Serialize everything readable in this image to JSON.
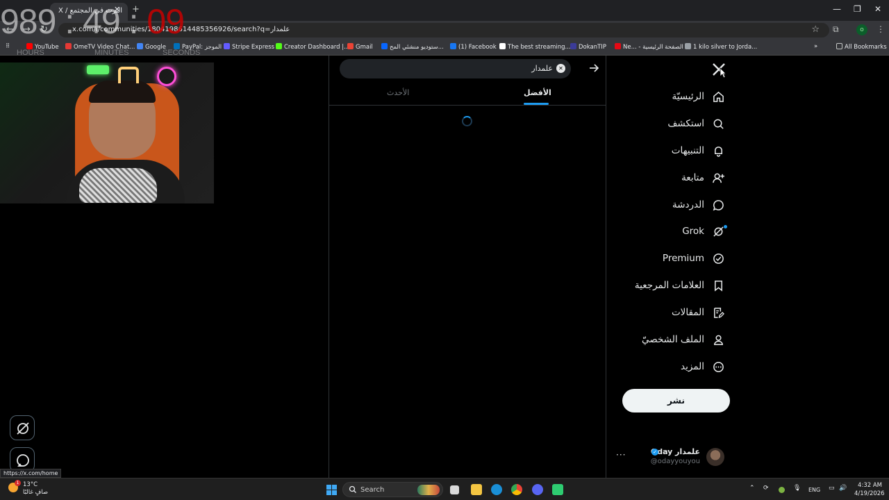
{
  "browser": {
    "tab_title": "الترث في المجتمع / X",
    "url": "x.com/i/communities/1804198614485356926/search?q=علمدار",
    "status_url": "https://x.com/home",
    "bookmarks": [
      {
        "label": "YouTube",
        "color": "#ff0000"
      },
      {
        "label": "OmeTV Video Chat...",
        "color": "#e53935"
      },
      {
        "label": "Google",
        "color": "#4285f4"
      },
      {
        "label": "PayPal: الموجز",
        "color": "#0070ba"
      },
      {
        "label": "Stripe Express",
        "color": "#635bff"
      },
      {
        "label": "Creator Dashboard |...",
        "color": "#53fc18"
      },
      {
        "label": "Gmail",
        "color": "#ea4335"
      },
      {
        "label": "ستوديو منشئي المح...",
        "color": "#0866ff"
      },
      {
        "label": "(1) Facebook",
        "color": "#1877f2"
      },
      {
        "label": "The best streaming...",
        "color": "#ffffff"
      },
      {
        "label": "DokanTIP",
        "color": "#3b3b98"
      },
      {
        "label": "Ne... - الصفحة الرئيسية",
        "color": "#e50914"
      },
      {
        "label": "1 kilo silver to Jorda...",
        "color": "#9aa0a6"
      }
    ],
    "all_bookmarks": "All Bookmarks",
    "profile_initial": "o"
  },
  "overlay": {
    "timer_hm": "989 : 49 : ",
    "timer_s": "09",
    "labels": [
      "HOURS",
      "MINUTES",
      "SECONDS"
    ]
  },
  "search": {
    "query": "علمدار",
    "tabs": [
      {
        "label": "الأفضل",
        "active": true
      },
      {
        "label": "الأحدث",
        "active": false
      }
    ]
  },
  "nav": [
    {
      "label": "الرئيسيّة",
      "icon": "home-icon"
    },
    {
      "label": "استكشف",
      "icon": "search-icon"
    },
    {
      "label": "التنبيهات",
      "icon": "bell-icon"
    },
    {
      "label": "متابعة",
      "icon": "follow-icon"
    },
    {
      "label": "الدردشة",
      "icon": "chat-icon"
    },
    {
      "label": "Grok",
      "icon": "grok-icon"
    },
    {
      "label": "Premium",
      "icon": "premium-icon"
    },
    {
      "label": "العلامات المرجعية",
      "icon": "bookmark-icon"
    },
    {
      "label": "المقالات",
      "icon": "articles-icon"
    },
    {
      "label": "الملف الشخصيّ",
      "icon": "profile-icon"
    },
    {
      "label": "المزيد",
      "icon": "more-icon"
    }
  ],
  "post_button": "نشر",
  "account": {
    "name": "Oday علمدار",
    "handle": "@odayyouyou"
  },
  "taskbar": {
    "temp": "13°C",
    "weather": "صافٍ غالبًا",
    "weather_badge": "1",
    "search": "Search",
    "lang": "ENG",
    "time": "4:32 AM",
    "date": "4/19/2026"
  }
}
